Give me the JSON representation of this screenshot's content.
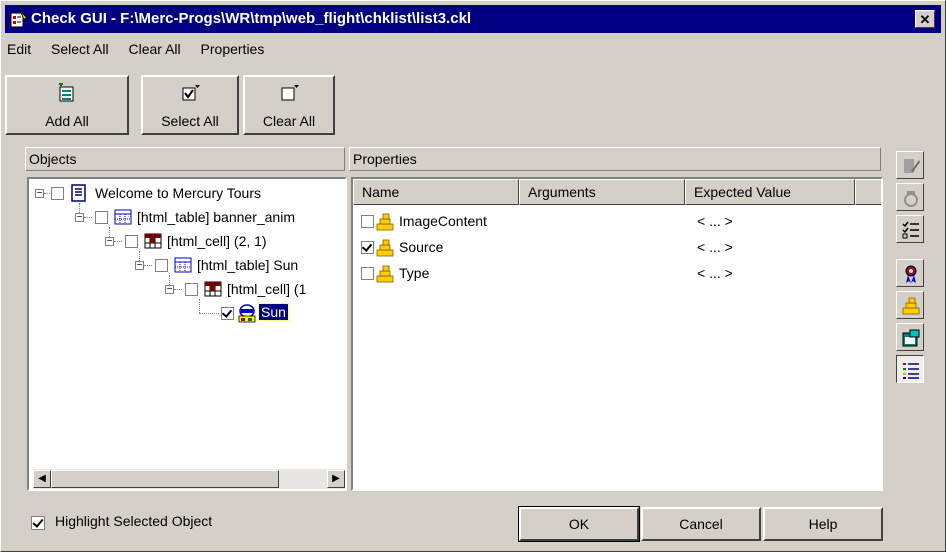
{
  "window": {
    "title": "Check GUI - F:\\Merc-Progs\\WR\\tmp\\web_flight\\chklist\\list3.ckl",
    "close_label": "✕"
  },
  "menu": {
    "items": [
      {
        "label": "Edit"
      },
      {
        "label": "Select All"
      },
      {
        "label": "Clear All"
      },
      {
        "label": "Properties"
      }
    ]
  },
  "toolbar": {
    "add_all": "Add All",
    "select_all": "Select All",
    "clear_all": "Clear All"
  },
  "objects": {
    "header": "Objects",
    "tree": [
      {
        "label": "Welcome to Mercury Tours",
        "icon": "html-page-icon",
        "checked": false,
        "expander": "minus"
      },
      {
        "label": "[html_table] banner_anim",
        "icon": "html-table-icon",
        "checked": false,
        "expander": "minus"
      },
      {
        "label": "[html_cell] (2, 1)",
        "icon": "html-cell-icon",
        "checked": false,
        "expander": "minus"
      },
      {
        "label": "[html_table] Sun",
        "icon": "html-table-icon",
        "checked": false,
        "expander": "minus"
      },
      {
        "label": "[html_cell] (1",
        "icon": "html-cell-icon",
        "checked": false,
        "expander": "minus"
      },
      {
        "label": "Sun",
        "icon": "image-object-icon",
        "checked": true,
        "selected": true
      }
    ]
  },
  "properties": {
    "header": "Properties",
    "columns": [
      "Name",
      "Arguments",
      "Expected Value"
    ],
    "rows": [
      {
        "name": "ImageContent",
        "arguments": "",
        "expected": "< ... >",
        "checked": false
      },
      {
        "name": "Source",
        "arguments": "",
        "expected": "< ... >",
        "checked": true
      },
      {
        "name": "Type",
        "arguments": "",
        "expected": "< ... >",
        "checked": false
      }
    ]
  },
  "side_toolbar": {
    "icons": [
      "edit-expected-icon",
      "compare-icon",
      "checklist-icon",
      "ribbon-icon",
      "property-icon",
      "window-icon",
      "list-view-icon"
    ]
  },
  "footer": {
    "highlight_label": "Highlight Selected Object",
    "highlight_checked": true,
    "ok": "OK",
    "cancel": "Cancel",
    "help": "Help"
  }
}
